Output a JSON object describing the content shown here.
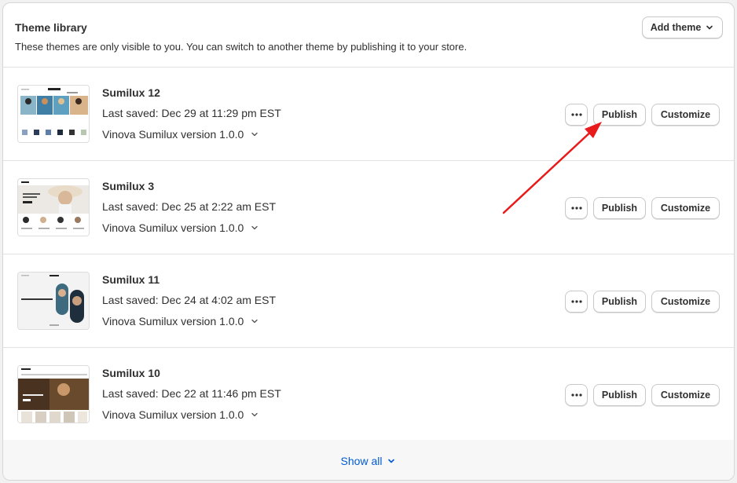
{
  "header": {
    "title": "Theme library",
    "subtitle": "These themes are only visible to you. You can switch to another theme by publishing it to your store.",
    "add_theme_label": "Add theme"
  },
  "themes": [
    {
      "name": "Sumilux 12",
      "last_saved": "Last saved: Dec 29 at 11:29 pm EST",
      "version": "Vinova Sumilux version 1.0.0",
      "publish_label": "Publish",
      "customize_label": "Customize"
    },
    {
      "name": "Sumilux 3",
      "last_saved": "Last saved: Dec 25 at 2:22 am EST",
      "version": "Vinova Sumilux version 1.0.0",
      "publish_label": "Publish",
      "customize_label": "Customize"
    },
    {
      "name": "Sumilux 11",
      "last_saved": "Last saved: Dec 24 at 4:02 am EST",
      "version": "Vinova Sumilux version 1.0.0",
      "publish_label": "Publish",
      "customize_label": "Customize"
    },
    {
      "name": "Sumilux 10",
      "last_saved": "Last saved: Dec 22 at 11:46 pm EST",
      "version": "Vinova Sumilux version 1.0.0",
      "publish_label": "Publish",
      "customize_label": "Customize"
    }
  ],
  "footer": {
    "show_all_label": "Show all"
  },
  "colors": {
    "link": "#005bd3",
    "annotation": "#e81a1a",
    "text": "#303030",
    "border": "#e3e3e3"
  },
  "icons": {
    "more": "ellipsis-icon",
    "expand": "chevron-down-icon"
  }
}
